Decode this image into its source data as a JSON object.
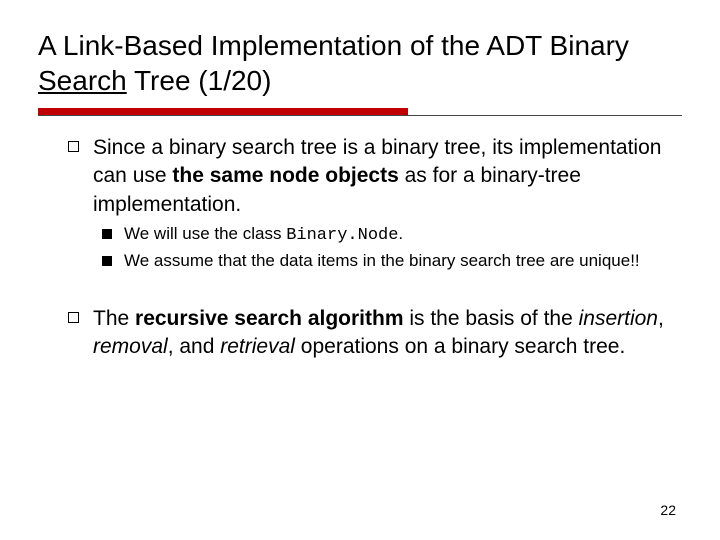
{
  "title": {
    "a": "A Link-Based Implementation of the ADT Binary ",
    "b": "Search",
    "c": " Tree (1/20)"
  },
  "l1a": {
    "pre": "Since a binary search tree is a binary tree, its implementation can use ",
    "bold": "the same node objects",
    "post": " as for a binary-tree implementation."
  },
  "l2a": {
    "pre": "We will use the class ",
    "code": "Binary.Node",
    "post": "."
  },
  "l2b": "We assume that the data items in the binary search tree are unique!!",
  "l1b": {
    "a": "The ",
    "b": "recursive search algorithm",
    "c": " is the basis of the ",
    "d": "insertion",
    "e": ", ",
    "f": "removal",
    "g": ", and ",
    "h": "retrieval",
    "i": " operations on a binary search tree."
  },
  "page": "22"
}
